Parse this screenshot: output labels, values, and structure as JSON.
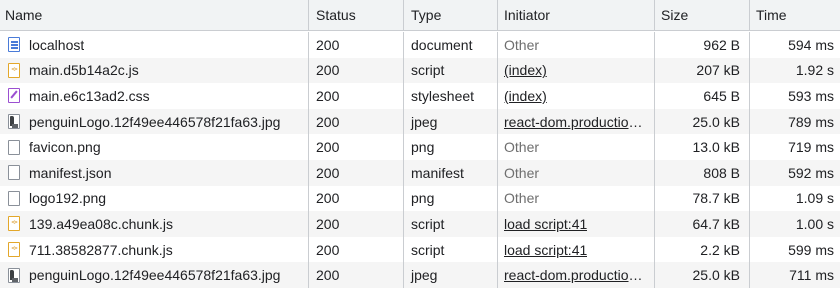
{
  "columns": {
    "name": "Name",
    "status": "Status",
    "type": "Type",
    "initiator": "Initiator",
    "size": "Size",
    "time": "Time"
  },
  "colors": {
    "header_bg": "#f1f3f4",
    "stripe_bg": "#f5f5f5",
    "grid_line": "#cacdd1",
    "doc_icon": "#4a7bd8",
    "script_icon": "#e3a72a",
    "stylesheet_icon": "#9b4fd1"
  },
  "requests": [
    {
      "name": "localhost",
      "icon": "document-icon",
      "status": "200",
      "type": "document",
      "initiator": "Other",
      "initiator_link": false,
      "size": "962 B",
      "time": "594 ms"
    },
    {
      "name": "main.d5b14a2c.js",
      "icon": "script-icon",
      "status": "200",
      "type": "script",
      "initiator": "(index)",
      "initiator_link": true,
      "size": "207 kB",
      "time": "1.92 s"
    },
    {
      "name": "main.e6c13ad2.css",
      "icon": "stylesheet-icon",
      "status": "200",
      "type": "stylesheet",
      "initiator": "(index)",
      "initiator_link": true,
      "size": "645 B",
      "time": "593 ms"
    },
    {
      "name": "penguinLogo.12f49ee446578f21fa63.jpg",
      "icon": "image-icon",
      "status": "200",
      "type": "jpeg",
      "initiator": "react-dom.production.min.js",
      "initiator_link": true,
      "size": "25.0 kB",
      "time": "789 ms"
    },
    {
      "name": "favicon.png",
      "icon": "file-icon",
      "status": "200",
      "type": "png",
      "initiator": "Other",
      "initiator_link": false,
      "size": "13.0 kB",
      "time": "719 ms"
    },
    {
      "name": "manifest.json",
      "icon": "file-icon",
      "status": "200",
      "type": "manifest",
      "initiator": "Other",
      "initiator_link": false,
      "size": "808 B",
      "time": "592 ms"
    },
    {
      "name": "logo192.png",
      "icon": "file-icon",
      "status": "200",
      "type": "png",
      "initiator": "Other",
      "initiator_link": false,
      "size": "78.7 kB",
      "time": "1.09 s"
    },
    {
      "name": "139.a49ea08c.chunk.js",
      "icon": "script-icon",
      "status": "200",
      "type": "script",
      "initiator": "load script:41",
      "initiator_link": true,
      "size": "64.7 kB",
      "time": "1.00 s"
    },
    {
      "name": "711.38582877.chunk.js",
      "icon": "script-icon",
      "status": "200",
      "type": "script",
      "initiator": "load script:41",
      "initiator_link": true,
      "size": "2.2 kB",
      "time": "599 ms"
    },
    {
      "name": "penguinLogo.12f49ee446578f21fa63.jpg",
      "icon": "image-icon",
      "status": "200",
      "type": "jpeg",
      "initiator": "react-dom.production.min.js",
      "initiator_link": true,
      "size": "25.0 kB",
      "time": "711 ms"
    }
  ]
}
